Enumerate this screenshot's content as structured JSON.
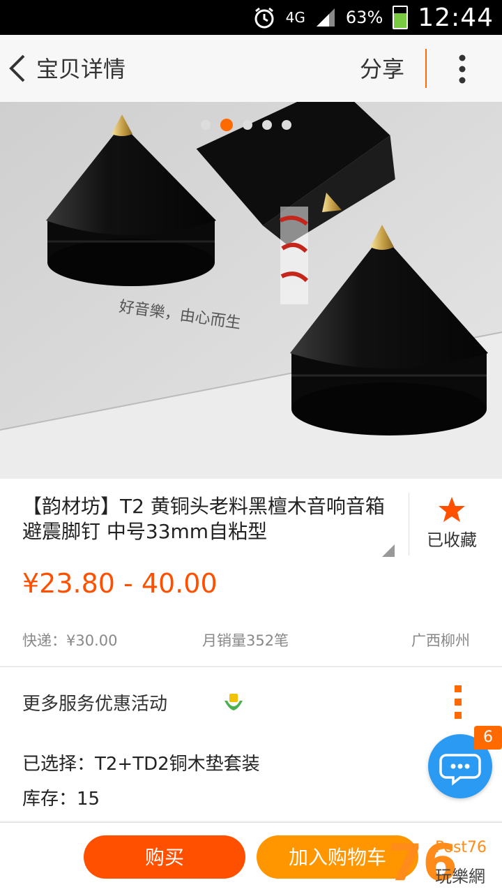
{
  "status_bar": {
    "network": "4G",
    "battery": "63%",
    "time": "12:44"
  },
  "topbar": {
    "back_icon": "chevron-left-icon",
    "title": "宝贝详情",
    "share": "分享",
    "more_icon": "vertical-dots-icon"
  },
  "gallery": {
    "image_count": 5,
    "active_index": 1,
    "caption_text": "好音樂，由心而生"
  },
  "product": {
    "title": "【韵材坊】T2 黄铜头老料黑檀木音响音箱避震脚钉 中号33mm自粘型",
    "favorite_label": "已收藏",
    "price": "¥23.80 - 40.00",
    "shipping": "快递：¥30.00",
    "monthly_sales": "月销量352笔",
    "location": "广西柳州"
  },
  "services": {
    "label": "更多服务优惠活动"
  },
  "sku": {
    "selected": "已选择：T2+TD2铜木垫套装",
    "stock": "库存：15"
  },
  "chat": {
    "badge": "6"
  },
  "bottom": {
    "buy": "购买",
    "add_cart": "加入购物车"
  },
  "watermark": {
    "number": "76",
    "post": "Post76",
    "cn": "玩樂網"
  },
  "colors": {
    "accent": "#ff5000",
    "cart": "#ff9600",
    "chat": "#2a9af3"
  }
}
